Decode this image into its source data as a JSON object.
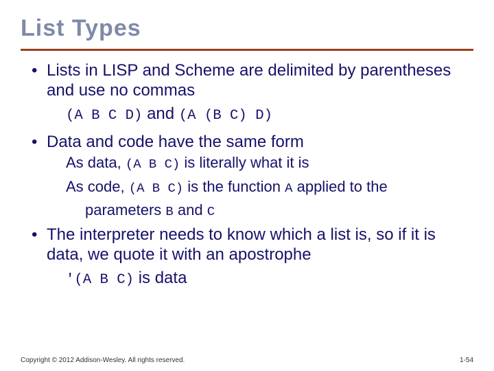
{
  "title": "List Types",
  "bullets": {
    "b1": "Lists in LISP and Scheme are delimited by parentheses and use no commas",
    "b1_ex_code1": "(A B C D)",
    "b1_ex_mid": " and ",
    "b1_ex_code2": "(A (B C) D)",
    "b2": "Data and code have the same form",
    "b2_s1_pre": "As data, ",
    "b2_s1_code": "(A B C)",
    "b2_s1_post": " is literally what it is",
    "b2_s2_pre": "As code, ",
    "b2_s2_code": "(A B C)",
    "b2_s2_mid": " is the function ",
    "b2_s2_codeA": "A",
    "b2_s2_post": " applied to the",
    "b2_s3_pre": "parameters ",
    "b2_s3_codeB": "B",
    "b2_s3_mid": " and ",
    "b2_s3_codeC": "C",
    "b3": "The interpreter needs to know which a list is, so if it is data, we quote it with an apostrophe",
    "b3_ex_code": "'(A B C)",
    "b3_ex_post": " is data"
  },
  "footer": {
    "copyright": "Copyright © 2012 Addison-Wesley. All rights reserved.",
    "pagenum": "1-54"
  }
}
